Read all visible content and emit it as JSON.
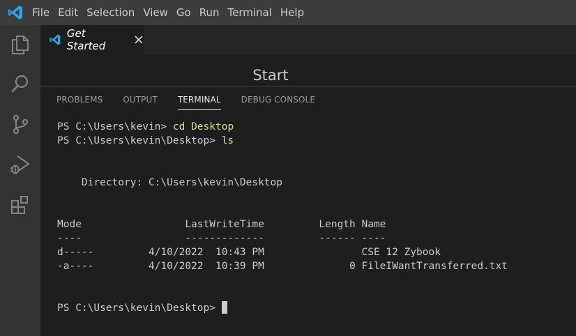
{
  "menubar": {
    "items": [
      "File",
      "Edit",
      "Selection",
      "View",
      "Go",
      "Run",
      "Terminal",
      "Help"
    ]
  },
  "activitybar": {
    "icons": [
      "explorer-icon",
      "search-icon",
      "source-control-icon",
      "run-debug-icon",
      "extensions-icon"
    ]
  },
  "editor": {
    "tab_label": "Get Started",
    "start_title": "Start"
  },
  "panel": {
    "tabs": [
      "PROBLEMS",
      "OUTPUT",
      "TERMINAL",
      "DEBUG CONSOLE"
    ],
    "active_tab": "TERMINAL"
  },
  "terminal": {
    "line1_prompt": "PS C:\\Users\\kevin> ",
    "line1_cmd": "cd Desktop",
    "line2_prompt": "PS C:\\Users\\kevin\\Desktop> ",
    "line2_cmd": "ls",
    "directory_line": "    Directory: C:\\Users\\kevin\\Desktop",
    "header_line": "Mode                 LastWriteTime         Length Name",
    "divider_line": "----                 -------------         ------ ----",
    "rows": [
      "d-----         4/10/2022  10:43 PM                CSE 12 Zybook",
      "-a----         4/10/2022  10:39 PM              0 FileIWantTransferred.txt"
    ],
    "final_prompt": "PS C:\\Users\\kevin\\Desktop> "
  },
  "colors": {
    "menubar_bg": "#3c3c3c",
    "activitybar_bg": "#333333",
    "editor_bg": "#1e1e1e",
    "vscode_blue": "#23a9f2",
    "command_yellow": "#dcdcaa"
  }
}
